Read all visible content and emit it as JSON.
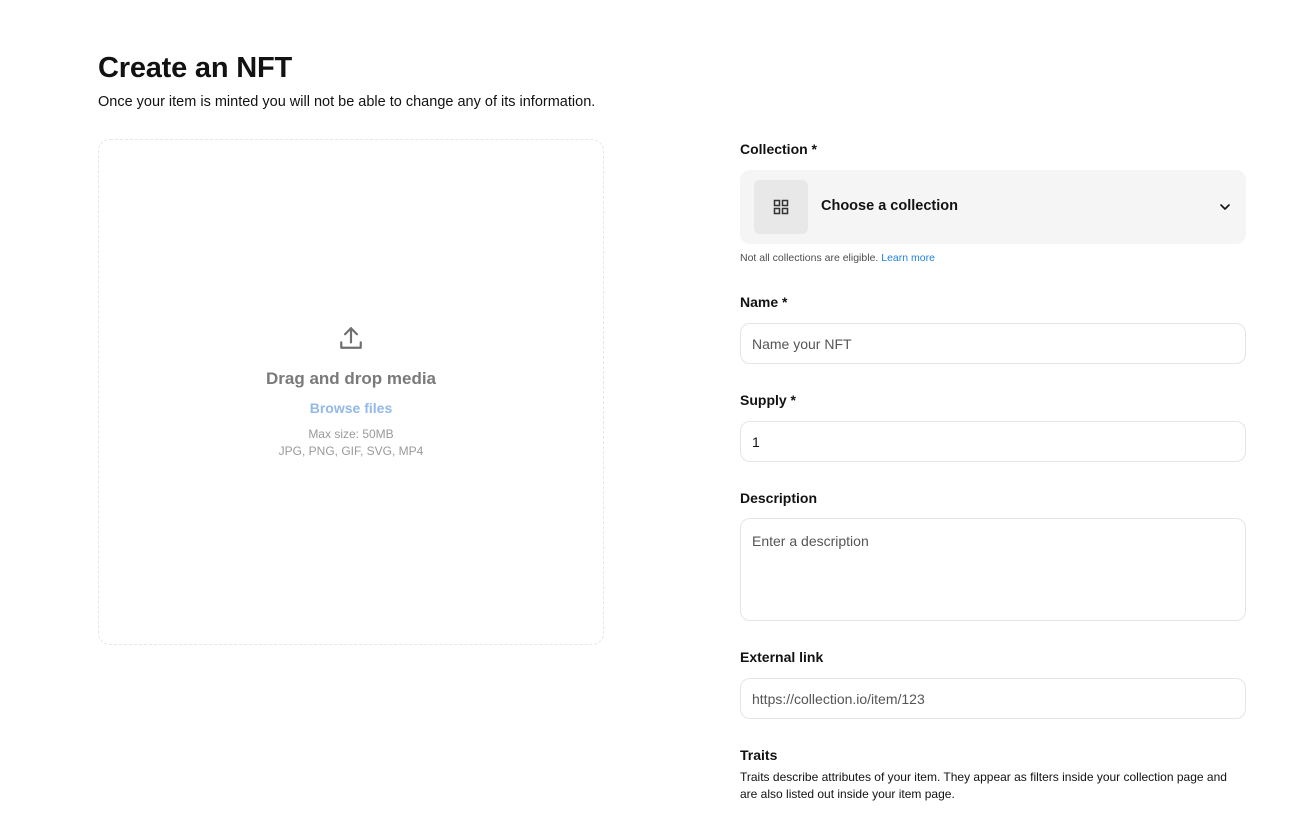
{
  "header": {
    "title": "Create an NFT",
    "subtitle": "Once your item is minted you will not be able to change any of its information."
  },
  "dropzone": {
    "title": "Drag and drop media",
    "browse_label": "Browse files",
    "max_size": "Max size: 50MB",
    "formats": "JPG, PNG, GIF, SVG, MP4"
  },
  "form": {
    "collection": {
      "label": "Collection *",
      "select_label": "Choose a collection",
      "helper": "Not all collections are eligible.",
      "helper_link": "Learn more"
    },
    "name": {
      "label": "Name *",
      "placeholder": "Name your NFT",
      "value": ""
    },
    "supply": {
      "label": "Supply *",
      "value": "1"
    },
    "description": {
      "label": "Description",
      "placeholder": "Enter a description",
      "value": ""
    },
    "external_link": {
      "label": "External link",
      "placeholder": "https://collection.io/item/123",
      "value": ""
    },
    "traits": {
      "label": "Traits",
      "description": "Traits describe attributes of your item. They appear as filters inside your collection page and are also listed out inside your item page."
    }
  },
  "icons": {
    "upload": "upload-icon",
    "grid": "grid-icon",
    "chevron": "chevron-down-icon"
  },
  "colors": {
    "link": "#2081e2",
    "browse": "#93b8ea",
    "field_border": "#e5e5e5",
    "select_bg": "#f5f5f5"
  }
}
